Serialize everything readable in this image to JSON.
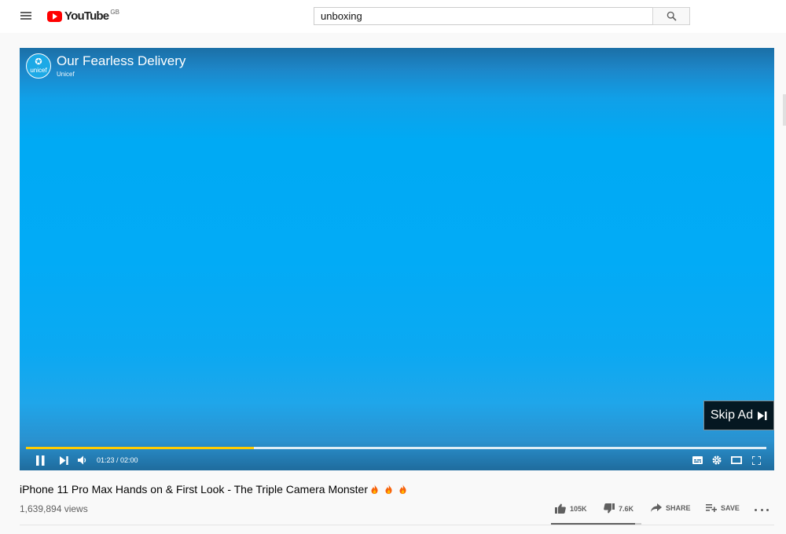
{
  "masthead": {
    "logo_text": "YouTube",
    "region": "GB",
    "search_value": "unboxing",
    "search_placeholder": "Search"
  },
  "player": {
    "ad": {
      "advertiser_logo_text": "unicef",
      "title": "Our Fearless Delivery",
      "channel": "Unicef"
    },
    "skip_label": "Skip Ad",
    "time_display": "01:23 / 02:00",
    "progress": 0.308,
    "icons": [
      "pause-icon",
      "next-icon",
      "volume-icon",
      "subtitles-icon",
      "settings-icon",
      "theater-icon",
      "fullscreen-icon"
    ],
    "progress_color": "#ffcc00"
  },
  "video": {
    "title": "iPhone 11 Pro Max Hands on & First Look - The Triple Camera Monster",
    "views": "1,639,894 views",
    "likes": "105K",
    "dislikes": "7.6K",
    "share_label": "SHARE",
    "save_label": "SAVE",
    "like_ratio": 0.93
  },
  "colors": {
    "brand_red": "#ff0000",
    "ad_blue": "#00aaf4"
  }
}
